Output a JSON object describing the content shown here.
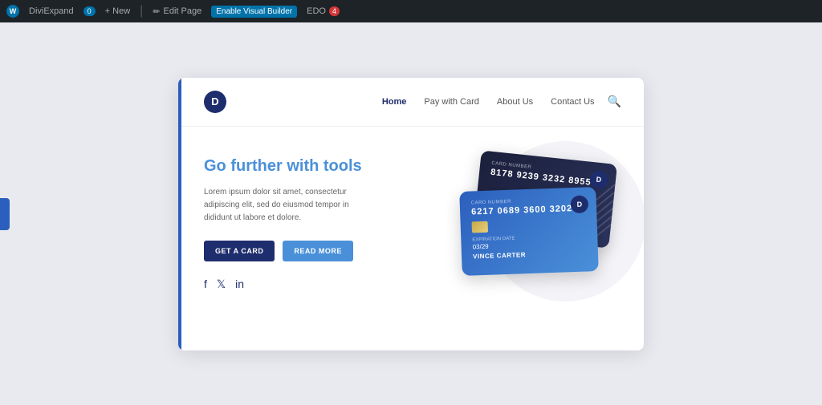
{
  "adminBar": {
    "logo": "W",
    "items": [
      {
        "label": "DiviExpand",
        "id": "diviexpand"
      },
      {
        "label": "0",
        "id": "comments-count"
      },
      {
        "label": "+ New",
        "id": "new"
      },
      {
        "label": "Edit Page",
        "id": "edit-page"
      },
      {
        "label": "Enable Visual Builder",
        "id": "visual-builder"
      },
      {
        "label": "EDO",
        "id": "edo"
      },
      {
        "label": "4",
        "id": "edo-count"
      }
    ]
  },
  "nav": {
    "logo_letter": "D",
    "links": [
      {
        "label": "Home",
        "active": true
      },
      {
        "label": "Pay with Card",
        "active": false
      },
      {
        "label": "About Us",
        "active": false
      },
      {
        "label": "Contact Us",
        "active": false
      }
    ]
  },
  "hero": {
    "heading_plain": "Go further with ",
    "heading_accent": "tools",
    "body_text": "Lorem ipsum dolor sit amet, consectetur adipiscing elit, sed do eiusmod tempor in dididunt ut labore et dolore.",
    "btn_primary": "GET A CARD",
    "btn_secondary": "READ MORE",
    "social": [
      "f",
      "t",
      "in"
    ]
  },
  "cards": {
    "dark_card": {
      "number_label": "CARD NUMBER",
      "number": "8178 9239 3232 8955",
      "logo": "D"
    },
    "blue_card": {
      "number_label": "CARD NUMBER",
      "number": "6217 0689 3600 3202",
      "logo": "D",
      "exp_label": "EXPIRATION DATE",
      "exp": "03/29",
      "name": "VINCE CARTER"
    }
  }
}
